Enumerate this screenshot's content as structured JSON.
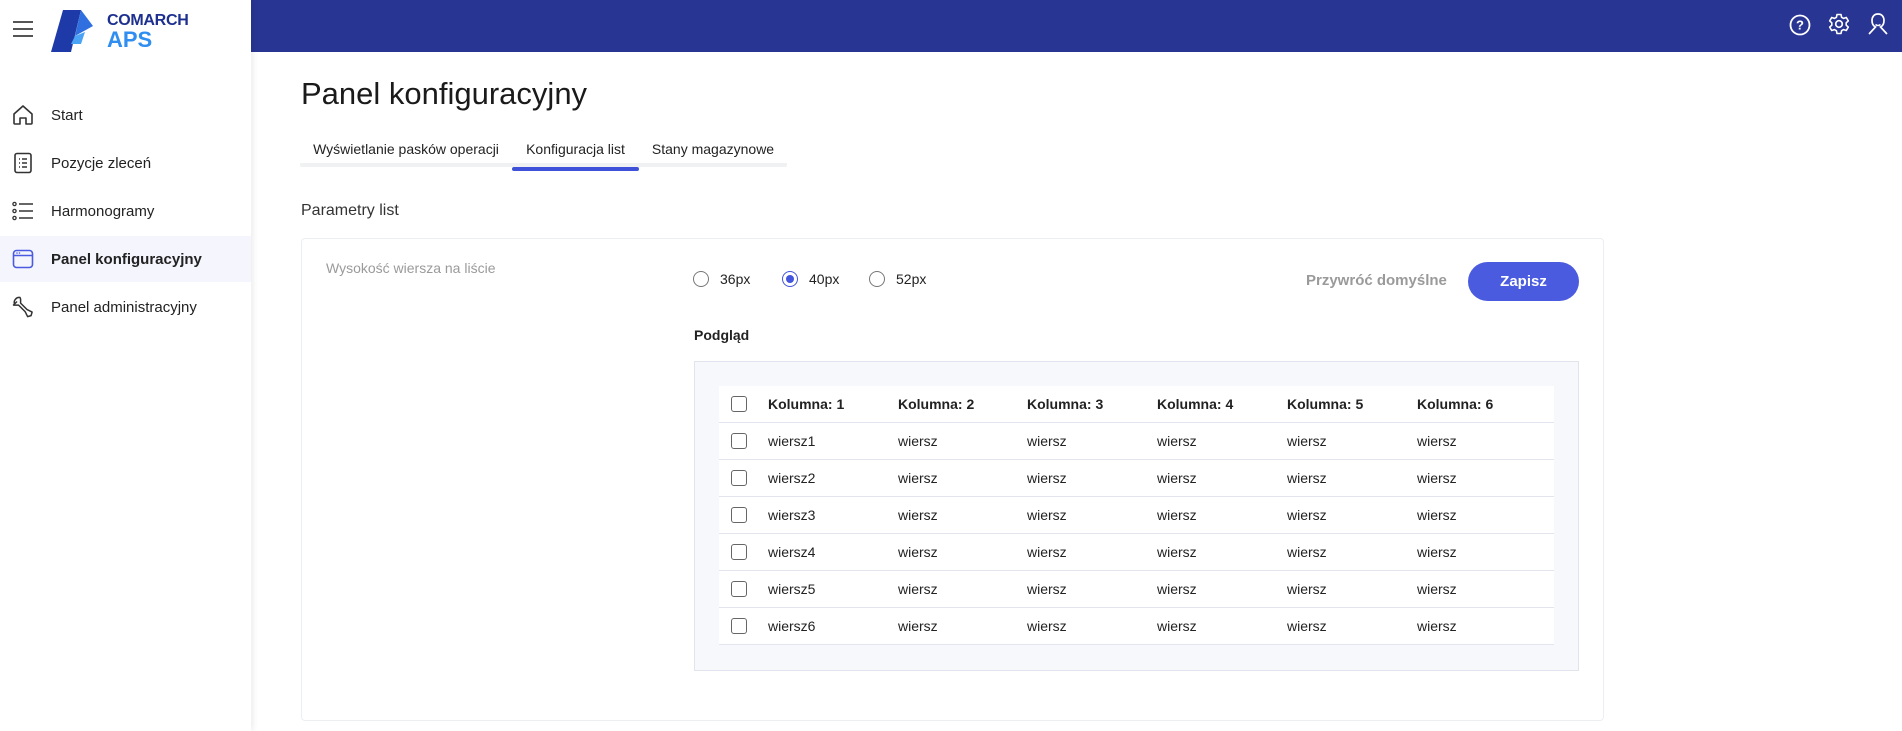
{
  "brand": {
    "line1": "COMARCH",
    "line2": "APS",
    "colors": {
      "topbar": "#283593",
      "accent": "#4a5be0"
    }
  },
  "topbar": {
    "icons": [
      "help-icon",
      "settings-icon",
      "user-icon"
    ]
  },
  "sidebar": {
    "items": [
      {
        "label": "Start",
        "icon": "home-icon"
      },
      {
        "label": "Pozycje zleceń",
        "icon": "list-document-icon"
      },
      {
        "label": "Harmonogramy",
        "icon": "bullet-list-icon"
      },
      {
        "label": "Panel konfiguracyjny",
        "icon": "window-icon",
        "active": true
      },
      {
        "label": "Panel administracyjny",
        "icon": "wrench-icon"
      }
    ]
  },
  "page": {
    "title": "Panel konfiguracyjny",
    "tabs": [
      {
        "label": "Wyświetlanie pasków operacji"
      },
      {
        "label": "Konfiguracja list",
        "active": true
      },
      {
        "label": "Stany magazynowe"
      }
    ],
    "section_title": "Parametry list",
    "row_height_label": "Wysokość wiersza na liście",
    "radio_options": [
      {
        "label": "36px"
      },
      {
        "label": "40px",
        "selected": true
      },
      {
        "label": "52px"
      }
    ],
    "reset_label": "Przywróć domyślne",
    "save_label": "Zapisz",
    "preview_label": "Podgląd",
    "preview_table": {
      "columns": [
        "Kolumna: 1",
        "Kolumna: 2",
        "Kolumna: 3",
        "Kolumna: 4",
        "Kolumna: 5",
        "Kolumna: 6"
      ],
      "rows": [
        [
          "wiersz1",
          "wiersz",
          "wiersz",
          "wiersz",
          "wiersz",
          "wiersz"
        ],
        [
          "wiersz2",
          "wiersz",
          "wiersz",
          "wiersz",
          "wiersz",
          "wiersz"
        ],
        [
          "wiersz3",
          "wiersz",
          "wiersz",
          "wiersz",
          "wiersz",
          "wiersz"
        ],
        [
          "wiersz4",
          "wiersz",
          "wiersz",
          "wiersz",
          "wiersz",
          "wiersz"
        ],
        [
          "wiersz5",
          "wiersz",
          "wiersz",
          "wiersz",
          "wiersz",
          "wiersz"
        ],
        [
          "wiersz6",
          "wiersz",
          "wiersz",
          "wiersz",
          "wiersz",
          "wiersz"
        ]
      ]
    }
  }
}
